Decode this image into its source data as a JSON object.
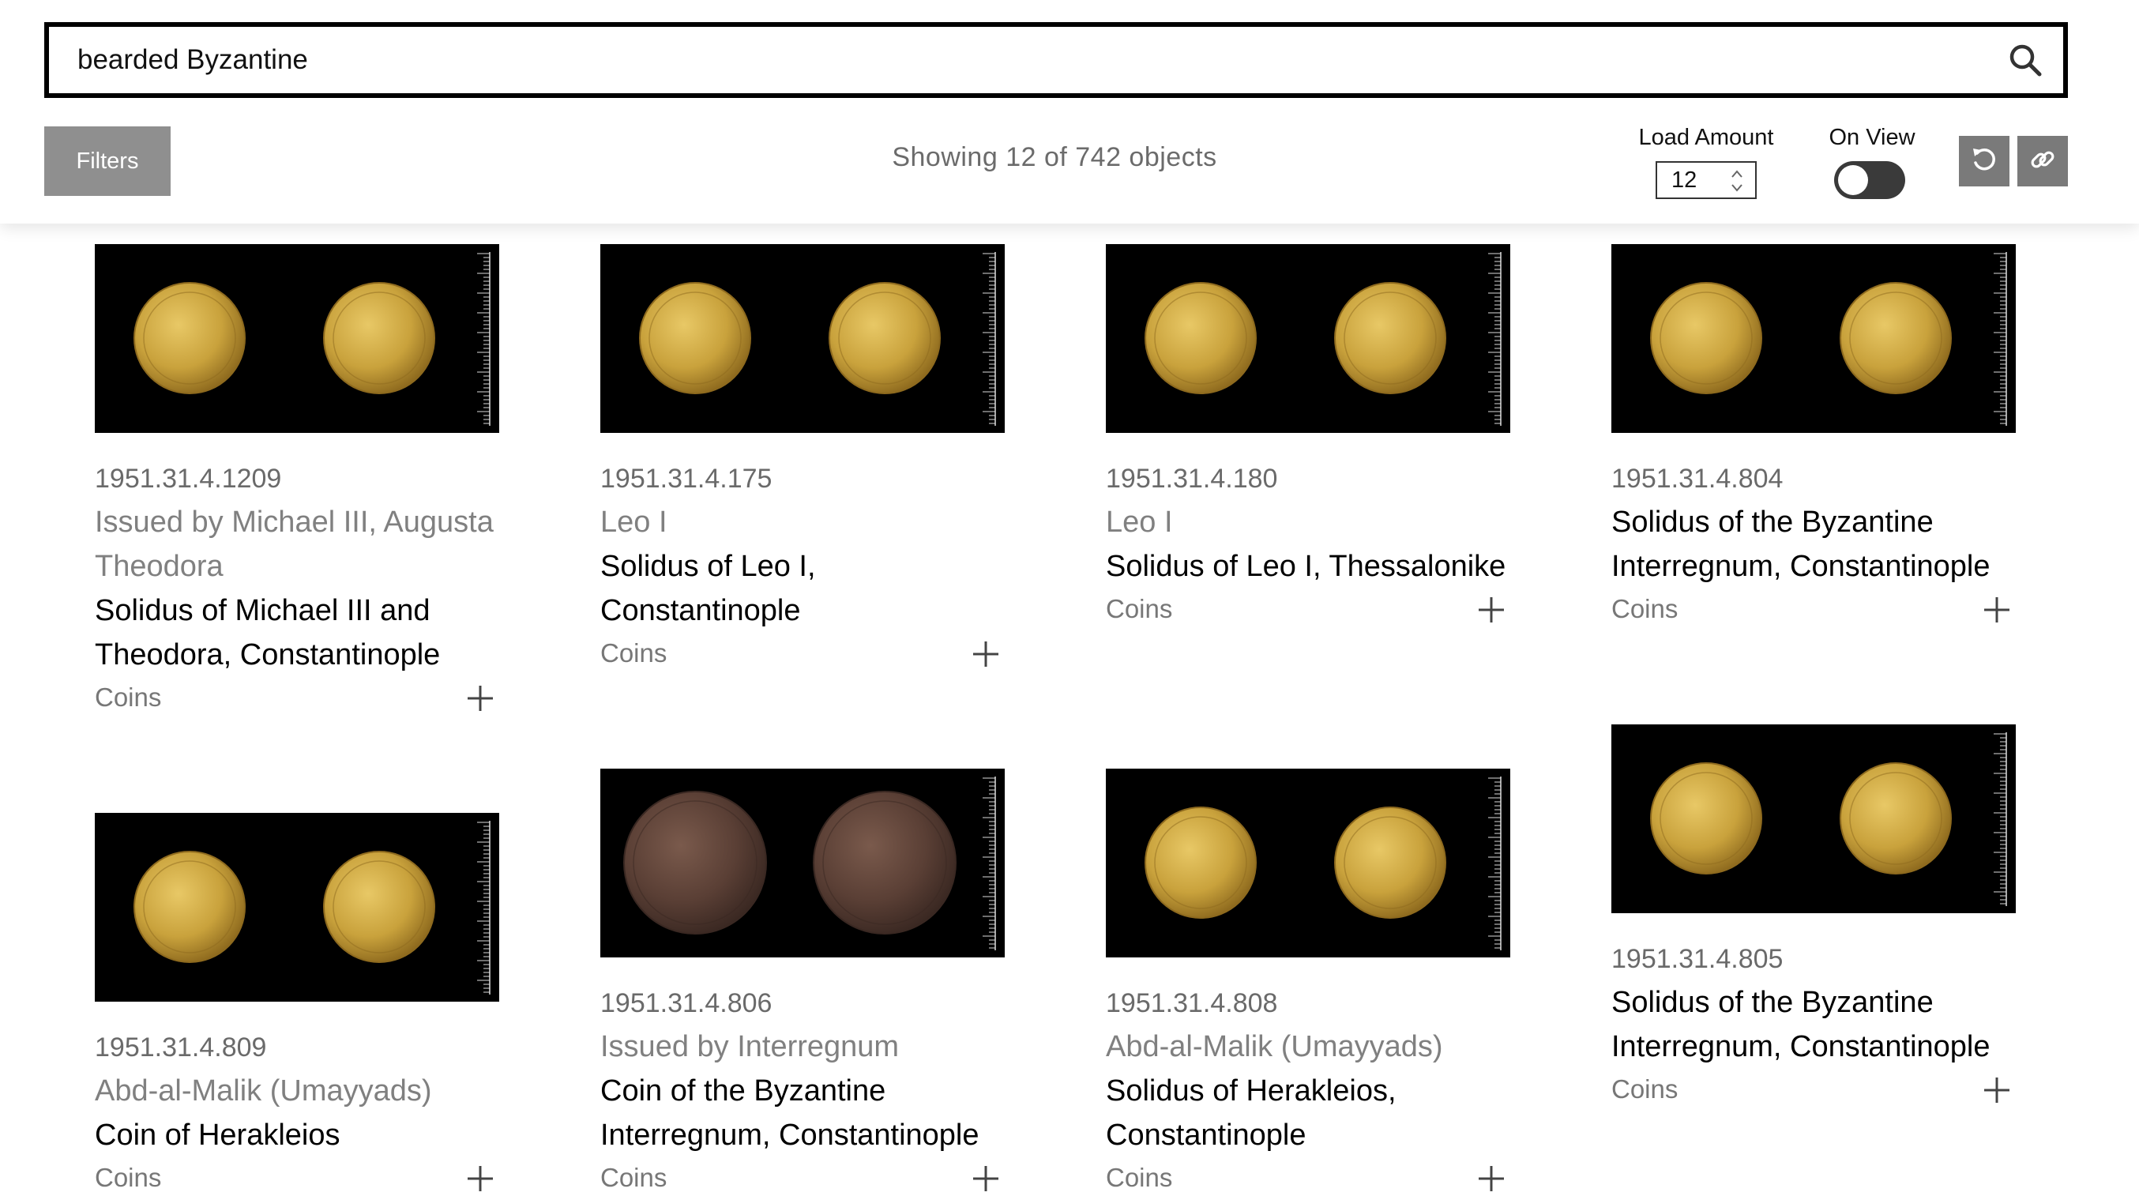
{
  "search": {
    "value": "bearded Byzantine"
  },
  "toolbar": {
    "filters_label": "Filters",
    "results_text": "Showing 12 of 742 objects",
    "load_amount_label": "Load Amount",
    "load_amount_value": "12",
    "on_view_label": "On View",
    "on_view_enabled": false
  },
  "icons": {
    "search": "search-icon",
    "reset": "reset-icon",
    "link": "link-icon",
    "add": "plus-icon"
  },
  "colors": {
    "filters_button": "#8f8f8f",
    "icon_button": "#7a7a7a",
    "toggle_off": "#3a3a3a",
    "accession_text": "#6a6a6a",
    "maker_text": "#808080",
    "thumbnail_bg": "#000000",
    "gold_coin": "#c9a23c",
    "bronze_coin": "#5a3f35"
  },
  "results": [
    {
      "accession": "1951.31.4.1209",
      "maker": "Issued by Michael III, Augusta Theodora",
      "title": "Solidus of Michael III and Theodora, Constantinople",
      "classification": "Coins",
      "coin_metal": "gold"
    },
    {
      "accession": "1951.31.4.175",
      "maker": "Leo I",
      "title": "Solidus of Leo I, Constantinople",
      "classification": "Coins",
      "coin_metal": "gold"
    },
    {
      "accession": "1951.31.4.180",
      "maker": "Leo I",
      "title": "Solidus of Leo I, Thessalonike",
      "classification": "Coins",
      "coin_metal": "gold"
    },
    {
      "accession": "1951.31.4.804",
      "maker": "",
      "title": "Solidus of the Byzantine Interregnum, Constantinople",
      "classification": "Coins",
      "coin_metal": "gold"
    },
    {
      "accession": "1951.31.4.809",
      "maker": "Abd-al-Malik (Umayyads)",
      "title": "Coin of Herakleios",
      "classification": "Coins",
      "coin_metal": "gold"
    },
    {
      "accession": "1951.31.4.806",
      "maker": "Issued by Interregnum",
      "title": "Coin of the Byzantine Interregnum, Constantinople",
      "classification": "Coins",
      "coin_metal": "bronze"
    },
    {
      "accession": "1951.31.4.808",
      "maker": "Abd-al-Malik (Umayyads)",
      "title": "Solidus of Herakleios, Constantinople",
      "classification": "Coins",
      "coin_metal": "gold"
    },
    {
      "accession": "1951.31.4.805",
      "maker": "",
      "title": "Solidus of the Byzantine Interregnum, Constantinople",
      "classification": "Coins",
      "coin_metal": "gold"
    }
  ]
}
